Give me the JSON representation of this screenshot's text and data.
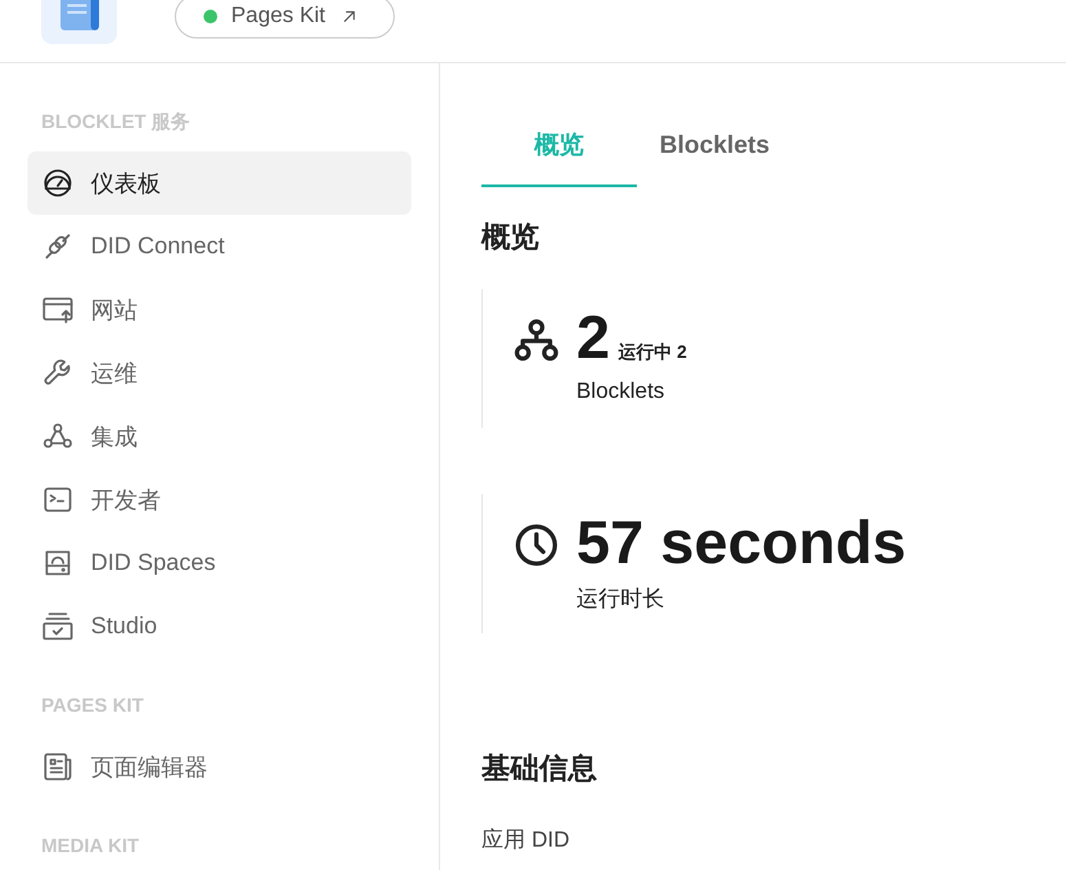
{
  "header": {
    "app_name": "Pages Kit",
    "online": true
  },
  "sidebar": {
    "sections": [
      {
        "title": "BLOCKLET 服务",
        "items": [
          {
            "label": "仪表板",
            "selected": true
          },
          {
            "label": "DID Connect",
            "selected": false
          },
          {
            "label": "网站",
            "selected": false
          },
          {
            "label": "运维",
            "selected": false
          },
          {
            "label": "集成",
            "selected": false
          },
          {
            "label": "开发者",
            "selected": false
          },
          {
            "label": "DID Spaces",
            "selected": false
          },
          {
            "label": "Studio",
            "selected": false
          }
        ]
      },
      {
        "title": "PAGES KIT",
        "items": [
          {
            "label": "页面编辑器",
            "selected": false
          }
        ]
      },
      {
        "title": "MEDIA KIT"
      }
    ]
  },
  "tabs": [
    {
      "label": "概览",
      "selected": true
    },
    {
      "label": "Blocklets",
      "selected": false
    }
  ],
  "overview": {
    "title": "概览",
    "stats": [
      {
        "value": "2",
        "note": "运行中 2",
        "label": "Blocklets"
      },
      {
        "value": "57 seconds",
        "label": "运行时长"
      }
    ]
  },
  "basic_info": {
    "title": "基础信息",
    "fields": [
      {
        "label": "应用 DID"
      }
    ]
  }
}
